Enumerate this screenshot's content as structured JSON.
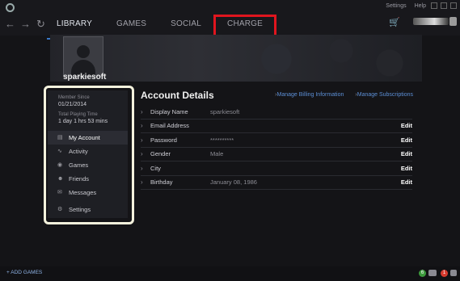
{
  "topbar": {
    "settings": "Settings",
    "help": "Help",
    "tabs": [
      "LIBRARY",
      "GAMES",
      "SOCIAL",
      "CHARGE"
    ]
  },
  "profile": {
    "username": "sparkiesoft",
    "member_since_label": "Member Since",
    "member_since": "01/21/2014",
    "playtime_label": "Total Playing Time",
    "playtime": "1 day 1 hrs 53 mins"
  },
  "sidebar": {
    "items": [
      {
        "label": "My Account",
        "icon": "account-icon"
      },
      {
        "label": "Activity",
        "icon": "activity-icon"
      },
      {
        "label": "Games",
        "icon": "gamepad-icon"
      },
      {
        "label": "Friends",
        "icon": "friends-icon"
      },
      {
        "label": "Messages",
        "icon": "messages-icon"
      },
      {
        "label": "Settings",
        "icon": "gear-icon"
      }
    ]
  },
  "main": {
    "title": "Account Details",
    "billing_link": "Manage Billing Information",
    "subs_link": "Manage Subscriptions",
    "rows": [
      {
        "label": "Display Name",
        "value": "sparkiesoft",
        "edit": ""
      },
      {
        "label": "Email Address",
        "value": "",
        "edit": "Edit"
      },
      {
        "label": "Password",
        "value": "**********",
        "edit": "Edit"
      },
      {
        "label": "Gender",
        "value": "Male",
        "edit": "Edit"
      },
      {
        "label": "City",
        "value": "",
        "edit": "Edit"
      },
      {
        "label": "Birthday",
        "value": "January 08, 1986",
        "edit": "Edit"
      }
    ]
  },
  "bottom": {
    "add_games": "ADD GAMES",
    "badge_green": "6",
    "badge_red": "1"
  },
  "colors": {
    "accent": "#3a78c8",
    "link": "#5c8fd6",
    "highlight_box": "#e0151e",
    "sidebar_outline": "#f4f2dd"
  }
}
